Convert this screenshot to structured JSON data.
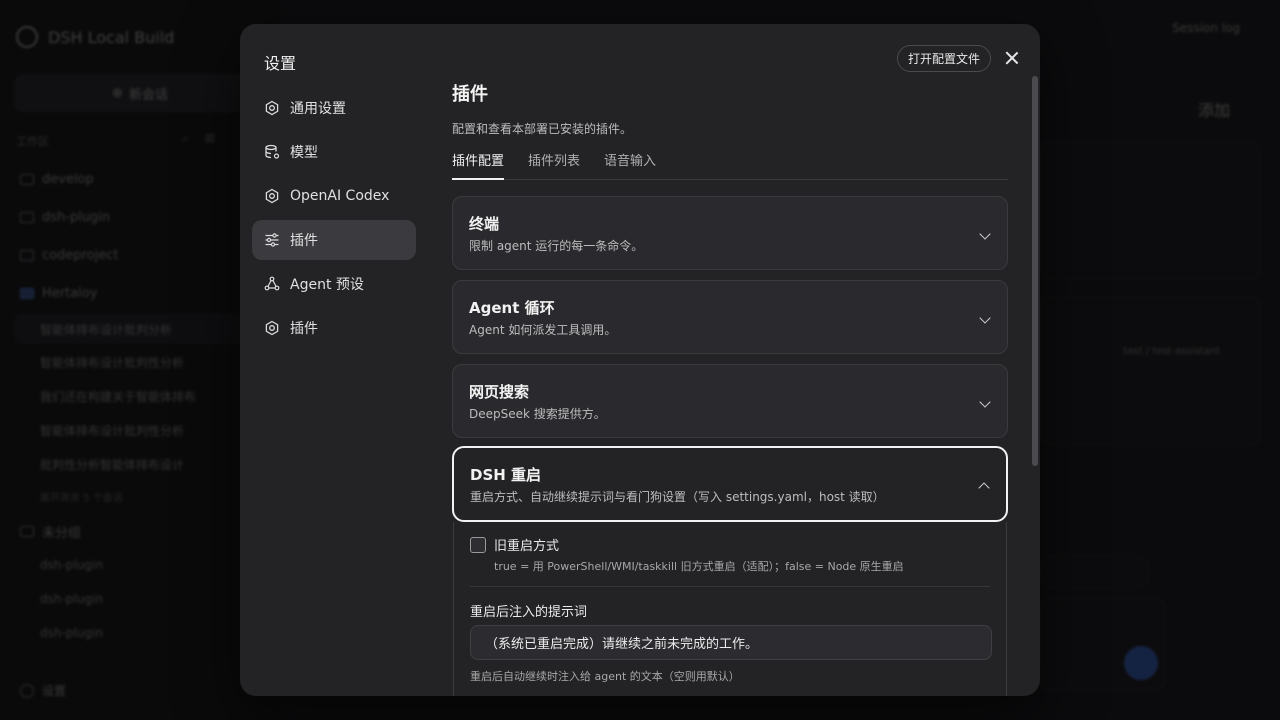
{
  "background": {
    "brand": "DSH Local Build",
    "new_chat": "新会话",
    "workspace_label": "工作区",
    "folders": [
      "develop",
      "dsh-plugin",
      "codeproject",
      "Hertaloy"
    ],
    "conversations": [
      "智能体排布设计批判分析",
      "智能体排布设计批判性分析",
      "我们还在构建关于智能体排布",
      "智能体排布设计批判性分析",
      "批判性分析智能体排布设计"
    ],
    "more_conversations": "展开其余 5 个会话",
    "ungrouped_label": "未分组",
    "ungrouped_items": [
      "dsh-plugin",
      "dsh-plugin",
      "dsh-plugin"
    ],
    "settings": "设置",
    "session_log": "Session log",
    "add": "添加",
    "tag": "test / test-assistant"
  },
  "modal": {
    "title": "设置",
    "open_config_label": "打开配置文件",
    "nav": [
      {
        "label": "通用设置",
        "icon": "gear-icon"
      },
      {
        "label": "模型",
        "icon": "database-icon"
      },
      {
        "label": "OpenAI Codex",
        "icon": "gear-icon"
      },
      {
        "label": "插件",
        "icon": "sliders-icon"
      },
      {
        "label": "Agent 预设",
        "icon": "preset-icon"
      },
      {
        "label": "插件",
        "icon": "gear-icon"
      }
    ],
    "active_nav": 3
  },
  "content": {
    "title": "插件",
    "description": "配置和查看本部署已安装的插件。",
    "tabs": [
      "插件配置",
      "插件列表",
      "语音输入"
    ],
    "active_tab": 0,
    "sections": [
      {
        "title": "终端",
        "description": "限制 agent 运行的每一条命令。",
        "expanded": false
      },
      {
        "title": "Agent 循环",
        "description": "Agent 如何派发工具调用。",
        "expanded": false
      },
      {
        "title": "网页搜索",
        "description": "DeepSeek 搜索提供方。",
        "expanded": false
      },
      {
        "title": "DSH 重启",
        "description": "重启方式、自动继续提示词与看门狗设置（写入 settings.yaml，host 读取）",
        "expanded": true
      }
    ],
    "dsh_restart": {
      "legacy_label": "旧重启方式",
      "legacy_checked": false,
      "legacy_help": "true = 用 PowerShell/WMI/taskkill 旧方式重启（适配）；false = Node 原生重启",
      "prompt_label": "重启后注入的提示词",
      "prompt_value": "（系统已重启完成）请继续之前未完成的工作。",
      "prompt_help": "重启后自动继续时注入给 agent 的文本（空则用默认）"
    }
  }
}
